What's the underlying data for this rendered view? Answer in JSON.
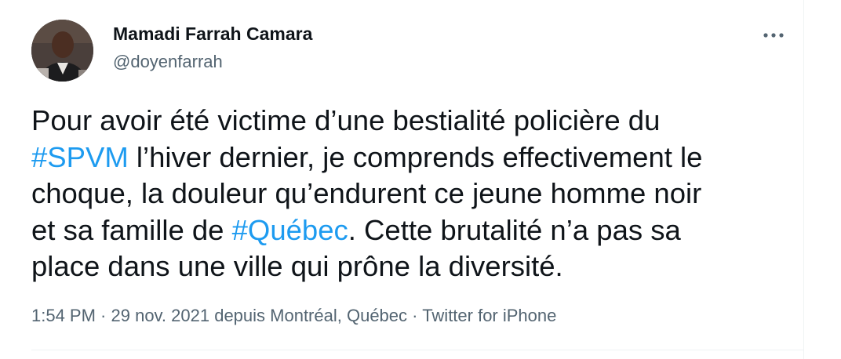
{
  "author": {
    "display_name": "Mamadi Farrah Camara",
    "handle": "@doyenfarrah"
  },
  "more_icon": "more-horizontal-icon",
  "tweet": {
    "lines": [
      [
        {
          "text": "Pour avoir été victime d’une bestialité policière du",
          "hashtag": false
        }
      ],
      [
        {
          "text": "#SPVM",
          "hashtag": true
        },
        {
          "text": " l’hiver dernier, je comprends effectivement le",
          "hashtag": false
        }
      ],
      [
        {
          "text": "choque, la douleur qu’endurent ce jeune homme noir",
          "hashtag": false
        }
      ],
      [
        {
          "text": "et sa famille de ",
          "hashtag": false
        },
        {
          "text": "#Québec",
          "hashtag": true
        },
        {
          "text": ". Cette brutalité n’a pas sa",
          "hashtag": false
        }
      ],
      [
        {
          "text": "place dans une ville qui prône la diversité.",
          "hashtag": false
        }
      ]
    ]
  },
  "meta": {
    "time": "1:54 PM",
    "separator": " · ",
    "date": "29 nov. 2021",
    "location": " depuis Montréal, Québec",
    "source": "Twitter for iPhone"
  },
  "colors": {
    "hashtag": "#1d9bf0",
    "text": "#0f1419",
    "secondary": "#536471"
  }
}
